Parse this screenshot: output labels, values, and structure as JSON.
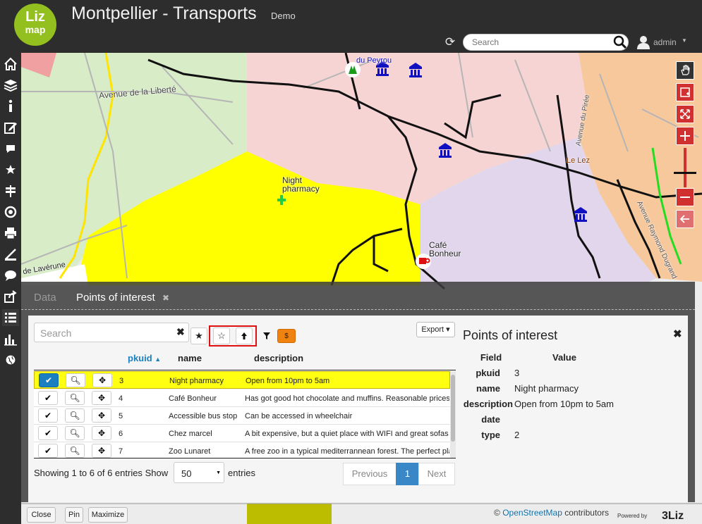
{
  "header": {
    "logo_line1": "Liz",
    "logo_line2": "map",
    "title": "Montpellier - Transports",
    "subtitle": "Demo",
    "search_placeholder": "Search",
    "user": "admin"
  },
  "menu": {
    "items": [
      {
        "icon": "home-icon"
      },
      {
        "icon": "layers-icon"
      },
      {
        "icon": "info-icon"
      },
      {
        "icon": "edit-icon"
      },
      {
        "icon": "comment-icon"
      },
      {
        "icon": "star-icon"
      },
      {
        "icon": "signpost-icon"
      },
      {
        "icon": "locate-icon"
      },
      {
        "icon": "print-icon"
      },
      {
        "icon": "measure-icon"
      },
      {
        "icon": "chat-icon"
      },
      {
        "icon": "share-icon"
      },
      {
        "icon": "list-icon"
      },
      {
        "icon": "chart-icon"
      },
      {
        "icon": "globe-icon"
      }
    ]
  },
  "map": {
    "labels": {
      "avenue_liberte": "Avenue de la Liberté",
      "night_pharmacy": "Night pharmacy",
      "cafe_bonheur": "Café Bonheur",
      "de_lavérune": "de Lavérune",
      "le_lez": "Le Lez",
      "avenue_piree": "Avenue du Pirée",
      "avenue_raymond": "Avenue Raymond Dugrand",
      "peyrou": "du Peyrou"
    },
    "colors": {
      "green_zone": "#d7ecc7",
      "pink_zone": "#f7d4d4",
      "yellow_zone": "#ffff00",
      "purple_zone": "#e2d6ec",
      "orange_zone": "#f7c89c",
      "accent_red": "#d03030"
    }
  },
  "dock": {
    "tab_data": "Data",
    "tab_poi": "Points of interest",
    "table": {
      "search_placeholder": "Search",
      "export_label": "Export",
      "headers": {
        "pkuid": "pkuid",
        "name": "name",
        "description": "description"
      },
      "rows": [
        {
          "pkuid": "3",
          "name": "Night pharmacy",
          "description": "Open from 10pm to 5am"
        },
        {
          "pkuid": "4",
          "name": "Café Bonheur",
          "description": "Has got good hot chocolate and muffins. Reasonable prices"
        },
        {
          "pkuid": "5",
          "name": "Accessible bus stop",
          "description": "Can be accessed in wheelchair"
        },
        {
          "pkuid": "6",
          "name": "Chez marcel",
          "description": "A bit expensive, but a quiet place with WIFI and great sofas :"
        },
        {
          "pkuid": "7",
          "name": "Zoo Lunaret",
          "description": "A free zoo in a typical mediterrannean forest. The perfect plac"
        }
      ],
      "info": "Showing 1 to 6 of 6 entries",
      "show_label": "Show",
      "page_size": "50",
      "entries_label": "entries",
      "prev_label": "Previous",
      "page": "1",
      "next_label": "Next",
      "count_badge": "$"
    },
    "attributes": {
      "title": "Points of interest",
      "field_header": "Field",
      "value_header": "Value",
      "fields": [
        {
          "key": "pkuid",
          "value": "3"
        },
        {
          "key": "name",
          "value": "Night pharmacy"
        },
        {
          "key": "description",
          "value": "Open from 10pm to 5am"
        },
        {
          "key": "date",
          "value": ""
        },
        {
          "key": "type",
          "value": "2"
        }
      ]
    }
  },
  "bottom": {
    "close": "Close",
    "pin": "Pin",
    "maximize": "Maximize",
    "credit_symbol": "©",
    "credit_link": "OpenStreetMap",
    "credit_text": "contributors",
    "powered": "Powered by",
    "brand": "3Liz"
  }
}
